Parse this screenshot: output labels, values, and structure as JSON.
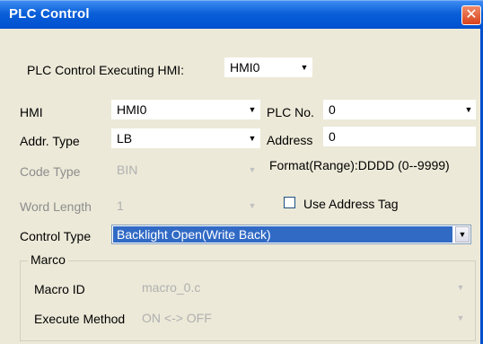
{
  "window": {
    "title": "PLC Control",
    "close_glyph": "✕"
  },
  "executing_hmi": {
    "label": "PLC Control Executing HMI:",
    "value": "HMI0"
  },
  "hmi": {
    "label": "HMI",
    "value": "HMI0"
  },
  "plc_no": {
    "label": "PLC No.",
    "value": "0"
  },
  "addr_type": {
    "label": "Addr. Type",
    "value": "LB"
  },
  "address": {
    "label": "Address",
    "value": "0",
    "format_hint": "Format(Range):DDDD (0--9999)"
  },
  "code_type": {
    "label": "Code Type",
    "value": "BIN"
  },
  "word_length": {
    "label": "Word Length",
    "value": "1"
  },
  "use_address_tag": {
    "label": "Use Address Tag",
    "checked": false
  },
  "control_type": {
    "label": "Control Type",
    "value": "Backlight Open(Write Back)"
  },
  "macro_group": {
    "title": "Marco",
    "macro_id": {
      "label": "Macro ID",
      "value": "macro_0.c"
    },
    "execute_method": {
      "label": "Execute Method",
      "value": "ON <-> OFF"
    }
  },
  "icons": {
    "dropdown": "chevron-down-icon",
    "close": "close-icon"
  },
  "colors": {
    "titlebar": "#0a5fd8",
    "selection": "#316ac5",
    "dialog_bg": "#ece9d8"
  }
}
